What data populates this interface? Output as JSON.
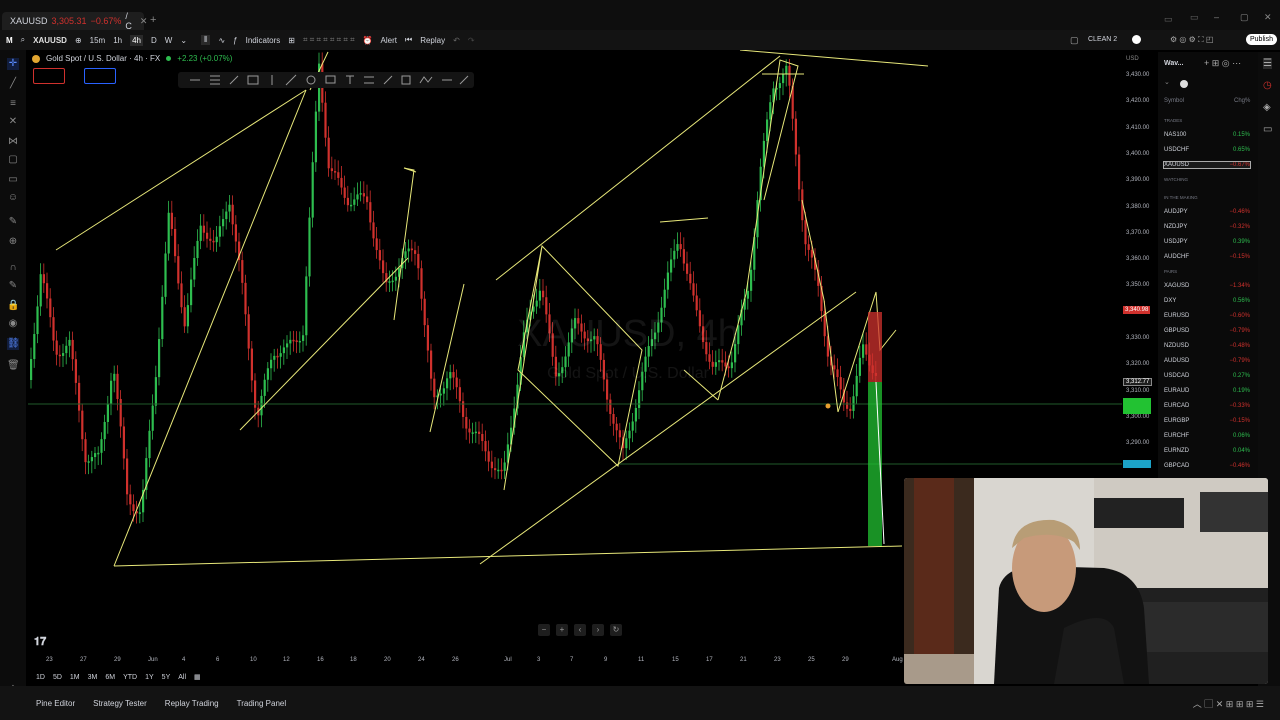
{
  "tab": {
    "symbol": "XAUUSD",
    "price": "3,305.31",
    "change": "−0.67%",
    "suffix": "/ C"
  },
  "toolbar": {
    "symbol": "XAUUSD",
    "intervals": [
      "15m",
      "1h",
      "4h",
      "D",
      "W"
    ],
    "indicators_label": "Indicators",
    "alert_label": "Alert",
    "replay_label": "Replay",
    "layout_label": "CLEAN 2",
    "publish_label": "Publish"
  },
  "legend": {
    "title": "Gold Spot / U.S. Dollar · 4h · FX",
    "change": "+2.23 (+0.07%)"
  },
  "watermark": {
    "main": "XAUUSD, 4h",
    "sub": "Gold Spot / U.S. Dollar"
  },
  "price_axis": {
    "currency": "USD",
    "ticks": [
      "3,430.00",
      "3,420.00",
      "3,410.00",
      "3,400.00",
      "3,390.00",
      "3,380.00",
      "3,370.00",
      "3,360.00",
      "3,350.00",
      "3,340.00",
      "3,330.00",
      "3,320.00",
      "3,310.00",
      "3,300.00",
      "3,290.00"
    ],
    "current_price": "3,340.98",
    "crosshair_price": "3,312.77"
  },
  "time_axis": {
    "ticks": [
      "23",
      "27",
      "29",
      "Jun",
      "4",
      "6",
      "10",
      "12",
      "16",
      "18",
      "20",
      "24",
      "26",
      "Jul",
      "3",
      "7",
      "9",
      "11",
      "15",
      "17",
      "21",
      "23",
      "25",
      "29",
      "Aug"
    ]
  },
  "range_bar": {
    "ranges": [
      "1D",
      "5D",
      "1M",
      "3M",
      "6M",
      "YTD",
      "1Y",
      "5Y",
      "All"
    ]
  },
  "bottom_bar": {
    "items": [
      "Pine Editor",
      "Strategy Tester",
      "Replay Trading",
      "Trading Panel"
    ]
  },
  "watchlist": {
    "title": "Wav...",
    "col_symbol": "Symbol",
    "col_change": "Chg%",
    "sections": [
      "TRADES",
      "WATCHING",
      "IN THE MAKING",
      "PAIRS"
    ],
    "trades": [
      {
        "sym": "NAS100",
        "chg": "0.15%",
        "up": true
      },
      {
        "sym": "USDCHF",
        "chg": "0.65%",
        "up": true
      },
      {
        "sym": "XAUUSD",
        "chg": "−0.67%",
        "up": false
      }
    ],
    "making": [
      {
        "sym": "AUDJPY",
        "chg": "−0.46%",
        "up": false
      },
      {
        "sym": "NZDJPY",
        "chg": "−0.32%",
        "up": false
      },
      {
        "sym": "USDJPY",
        "chg": "0.39%",
        "up": true
      },
      {
        "sym": "AUDCHF",
        "chg": "−0.15%",
        "up": false
      }
    ],
    "pairs": [
      {
        "sym": "XAGUSD",
        "chg": "−1.34%",
        "up": false
      },
      {
        "sym": "DXY",
        "chg": "0.56%",
        "up": true
      },
      {
        "sym": "EURUSD",
        "chg": "−0.60%",
        "up": false
      },
      {
        "sym": "GBPUSD",
        "chg": "−0.79%",
        "up": false
      },
      {
        "sym": "NZDUSD",
        "chg": "−0.48%",
        "up": false
      },
      {
        "sym": "AUDUSD",
        "chg": "−0.79%",
        "up": false
      },
      {
        "sym": "USDCAD",
        "chg": "0.27%",
        "up": true
      },
      {
        "sym": "EURAUD",
        "chg": "0.19%",
        "up": true
      },
      {
        "sym": "EURCAD",
        "chg": "−0.33%",
        "up": false
      },
      {
        "sym": "EURGBP",
        "chg": "−0.15%",
        "up": false
      },
      {
        "sym": "EURCHF",
        "chg": "0.06%",
        "up": true
      },
      {
        "sym": "EURNZD",
        "chg": "0.04%",
        "up": true
      },
      {
        "sym": "GBPCAD",
        "chg": "−0.46%",
        "up": false
      }
    ]
  },
  "colors": {
    "up": "#2ebd4f",
    "down": "#d0312d",
    "drawing": "#e8e87a",
    "bg": "#000000",
    "panel": "#131313"
  }
}
